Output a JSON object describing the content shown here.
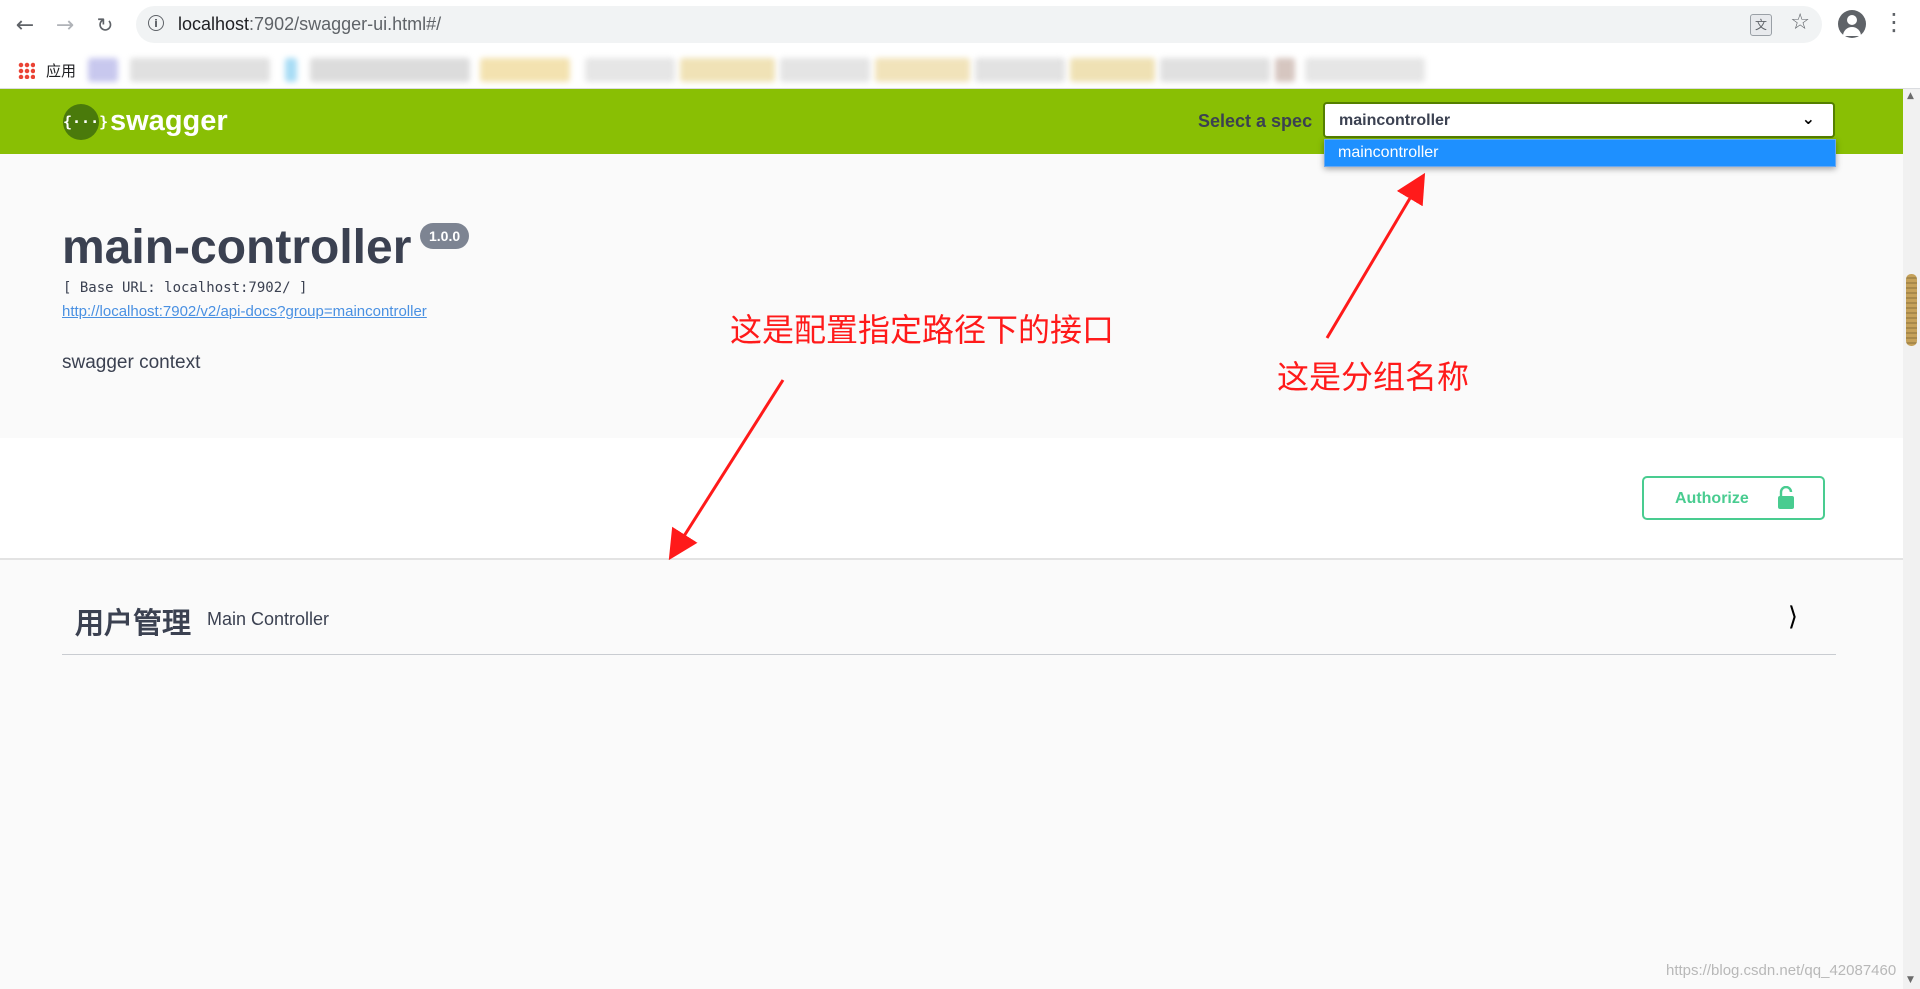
{
  "browser": {
    "url_host": "localhost",
    "url_path": ":7902/swagger-ui.html#/",
    "bookmarks_label": "应用",
    "translate_icon": "translate-icon"
  },
  "topbar": {
    "logo_symbol": "{···}",
    "logo_text": "swagger",
    "spec_label": "Select a spec",
    "spec_selected": "maincontroller",
    "spec_options": [
      "maincontroller"
    ],
    "brand_color": "#89bf04"
  },
  "info": {
    "title": "main-controller",
    "version": "1.0.0",
    "base_url": "[ Base URL: localhost:7902/ ]",
    "api_docs_link": "http://localhost:7902/v2/api-docs?group=maincontroller",
    "description": "swagger context"
  },
  "auth": {
    "authorize_label": "Authorize",
    "accent": "#49cc90"
  },
  "tags": [
    {
      "name": "用户管理",
      "description": "Main Controller"
    }
  ],
  "annotations": {
    "interface_note": "这是配置指定路径下的接口",
    "group_note": "这是分组名称",
    "color": "#ff1a1a"
  },
  "watermark": "https://blog.csdn.net/qq_42087460"
}
